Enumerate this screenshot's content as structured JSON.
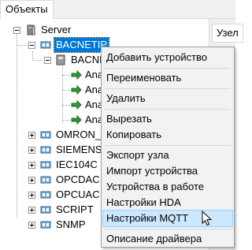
{
  "tabs": {
    "left_title": "Объекты",
    "right_title": "Узел"
  },
  "tree": {
    "root": "Server",
    "selected_node": "BACNETIP",
    "child_device": "BACNE",
    "analog_items": [
      "Ana",
      "Ana",
      "Ana",
      "Ana"
    ],
    "drivers": [
      "OMRON_",
      "SIEMENS",
      "IEC104C",
      "OPCDAC",
      "OPCUAC",
      "SCRIPT",
      "SNMP"
    ]
  },
  "context_menu": {
    "add_device": "Добавить устройство",
    "rename": "Переименовать",
    "delete": "Удалить",
    "cut": "Вырезать",
    "copy": "Копировать",
    "export_node": "Экспорт узла",
    "import_device": "Импорт устройства",
    "devices_in_work": "Устройства в работе",
    "hda_settings": "Настройки HDA",
    "mqtt_settings": "Настройки MQTT",
    "driver_description": "Описание драйвера",
    "highlighted_item": "Настройки MQTT"
  },
  "colors": {
    "selection": "#0078d7",
    "menu_highlight": "#cce8ff",
    "menu_bg": "#f2f2f2"
  }
}
